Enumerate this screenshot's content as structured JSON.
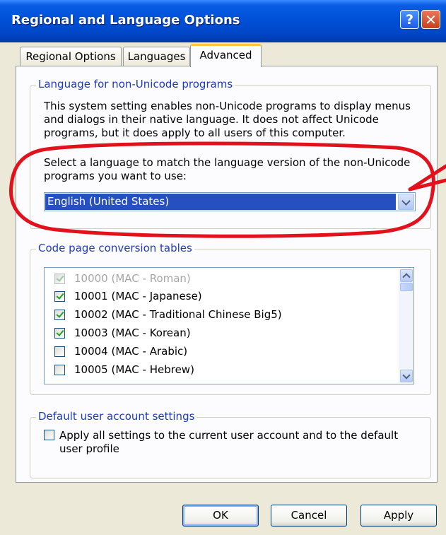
{
  "window": {
    "title": "Regional and Language Options"
  },
  "titlebar": {
    "help_glyph": "?",
    "close_glyph": "✕"
  },
  "tabs": [
    {
      "label": "Regional Options",
      "active": false
    },
    {
      "label": "Languages",
      "active": false
    },
    {
      "label": "Advanced",
      "active": true
    }
  ],
  "non_unicode": {
    "legend": "Language for non-Unicode programs",
    "description_lines": [
      "This system setting enables non-Unicode programs to display menus",
      "and dialogs in their native language. It does not affect Unicode",
      "programs, but it does apply to all users of this computer."
    ],
    "select_prompt_lines": [
      "Select a language to match the language version of the non-Unicode",
      "programs you want to use:"
    ],
    "selected_language": "English (United States)"
  },
  "code_pages": {
    "legend": "Code page conversion tables",
    "items": [
      {
        "label": "10000 (MAC - Roman)",
        "checked": true,
        "disabled": true
      },
      {
        "label": "10001 (MAC - Japanese)",
        "checked": true,
        "disabled": false
      },
      {
        "label": "10002 (MAC - Traditional Chinese Big5)",
        "checked": true,
        "disabled": false
      },
      {
        "label": "10003 (MAC - Korean)",
        "checked": true,
        "disabled": false
      },
      {
        "label": "10004 (MAC - Arabic)",
        "checked": false,
        "disabled": false
      },
      {
        "label": "10005 (MAC - Hebrew)",
        "checked": false,
        "disabled": false
      }
    ]
  },
  "default_user": {
    "legend": "Default user account settings",
    "checkbox_lines": [
      "Apply all settings to the current user account and to the default",
      "user profile"
    ],
    "checked": false
  },
  "buttons": {
    "ok": "OK",
    "cancel": "Cancel",
    "apply": "Apply"
  },
  "colors": {
    "titlebar": "#0050d8",
    "dialog_bg": "#ece9d8",
    "group_legend": "#1d3bbf",
    "selection": "#264fbf",
    "annotation": "#e3111b",
    "active_tab_highlight": "#ffc83c"
  },
  "icons": {
    "help": "help-icon",
    "close": "close-icon",
    "dropdown": "chevron-down-icon",
    "scroll_up": "chevron-up-icon",
    "scroll_down": "chevron-down-icon",
    "checkmark": "checkmark-icon"
  }
}
